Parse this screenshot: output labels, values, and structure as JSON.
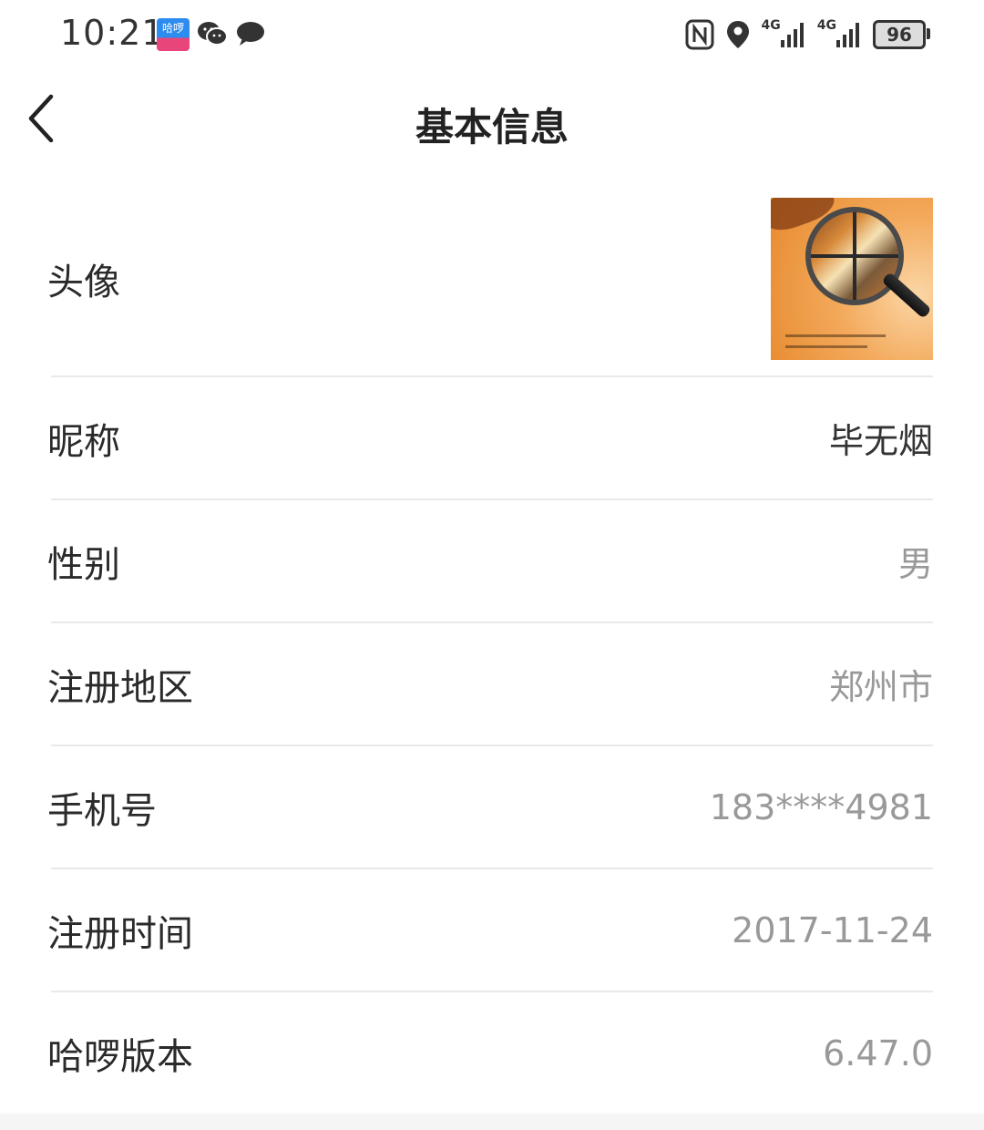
{
  "status_bar": {
    "time": "10:21",
    "app_badge_text": "哈啰",
    "network_1": "4G",
    "network_2": "4G",
    "battery": "96",
    "icons": [
      "halo-app-icon",
      "wechat-icon",
      "message-icon",
      "nfc-icon",
      "location-icon",
      "signal-icon",
      "signal-icon",
      "battery-icon"
    ]
  },
  "header": {
    "title": "基本信息",
    "back_icon": "chevron-left-icon"
  },
  "profile": {
    "avatar_label": "头像",
    "nickname_label": "昵称",
    "nickname_value": "毕无烟",
    "gender_label": "性别",
    "gender_value": "男",
    "region_label": "注册地区",
    "region_value": "郑州市",
    "phone_label": "手机号",
    "phone_value": "183****4981",
    "reg_time_label": "注册时间",
    "reg_time_value": "2017-11-24",
    "version_label": "哈啰版本",
    "version_value": "6.47.0"
  },
  "colors": {
    "title": "#222222",
    "label": "#2a2a2a",
    "value_muted": "#999999",
    "divider": "#e9e9e9",
    "avatar_accent": "#e6882c"
  }
}
